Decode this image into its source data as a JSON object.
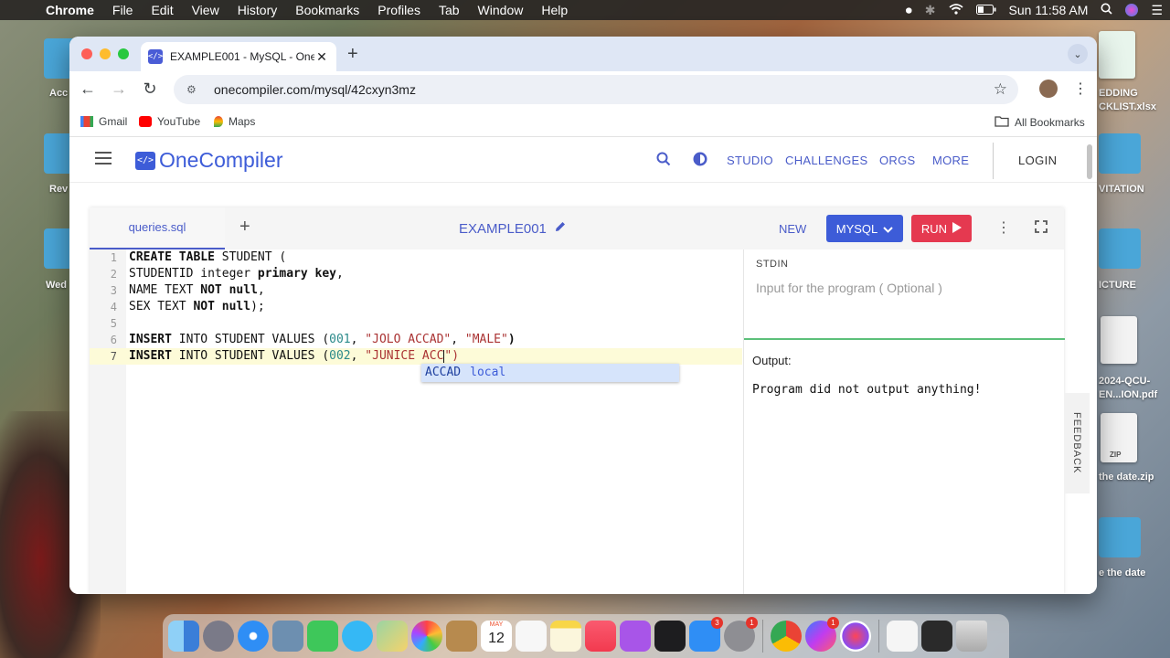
{
  "menubar": {
    "app": "Chrome",
    "items": [
      "File",
      "Edit",
      "View",
      "History",
      "Bookmarks",
      "Profiles",
      "Tab",
      "Window",
      "Help"
    ],
    "clock": "Sun 11:58 AM"
  },
  "desktop": {
    "left_labels": [
      "Acc",
      "Rev",
      "Wed"
    ],
    "right_labels": [
      "EDDING",
      "CKLIST.xlsx",
      "VITATION",
      "ICTURE",
      "2024-QCU-",
      "EN...ION.pdf",
      "ZIP",
      "the date.zip",
      "e the date"
    ]
  },
  "browser": {
    "tab_title": "EXAMPLE001 - MySQL - One",
    "tab_favicon": "</>",
    "url": "onecompiler.com/mysql/42cxyn3mz",
    "bookmarks": [
      "Gmail",
      "YouTube",
      "Maps"
    ],
    "all_bookmarks": "All Bookmarks"
  },
  "site": {
    "logo": "OneCompiler",
    "logo_mark": "</>",
    "nav": [
      "STUDIO",
      "CHALLENGES",
      "ORGS",
      "MORE"
    ],
    "login": "LOGIN"
  },
  "editor": {
    "file_tab": "queries.sql",
    "project_name": "EXAMPLE001",
    "new_label": "NEW",
    "language": "MYSQL",
    "run_label": "RUN",
    "line_numbers": [
      "1",
      "2",
      "3",
      "4",
      "5",
      "6",
      "7"
    ],
    "code": {
      "l1_kw": "CREATE TABLE",
      "l1_rest": " STUDENT (",
      "l2_a": "STUDENTID integer ",
      "l2_kw": "primary key",
      "l2_b": ",",
      "l3_a": "NAME TEXT ",
      "l3_kw": "NOT null",
      "l3_b": ",",
      "l4_a": "SEX TEXT ",
      "l4_kw": "NOT null",
      "l4_b": ");",
      "l6_kw": "INSERT",
      "l6_a": " INTO STUDENT VALUES (",
      "l6_num": "001",
      "l6_sep": ", ",
      "l6_str1": "\"JOLO ACCAD\"",
      "l6_sep2": ", ",
      "l6_str2": "\"MALE\"",
      "l6_end": ")",
      "l7_kw": "INSERT",
      "l7_a": " INTO STUDENT VALUES (",
      "l7_num": "002",
      "l7_sep": ", ",
      "l7_str": "\"JUNICE ACC",
      "l7_after": "\")"
    },
    "autocomplete": {
      "match": "ACCAD",
      "type": "local"
    }
  },
  "io": {
    "stdin_label": "STDIN",
    "stdin_placeholder": "Input for the program ( Optional )",
    "output_label": "Output:",
    "output_text": "Program did not output anything!"
  },
  "feedback": "FEEDBACK",
  "dock": {
    "apps": [
      "finder-icon",
      "launchpad-icon",
      "safari-icon",
      "preview-icon",
      "facetime-icon",
      "messages-icon",
      "maps-icon",
      "photos-icon",
      "contacts-icon",
      "calendar-icon",
      "reminders-icon",
      "notes-icon",
      "music-icon",
      "podcasts-icon",
      "tv-icon",
      "app-store-icon",
      "system-settings-icon",
      "chrome-icon",
      "messenger-icon",
      "siri-icon",
      "document-icon",
      "screenshot-icon",
      "trash-icon"
    ],
    "calendar_month": "MAY",
    "calendar_day": "12",
    "badges": {
      "app_store": "3",
      "system_settings": "1",
      "messenger": "1"
    }
  },
  "colors": {
    "accent": "#3d5cd8",
    "run": "#e53950",
    "active_line": "#fdfbd8"
  }
}
